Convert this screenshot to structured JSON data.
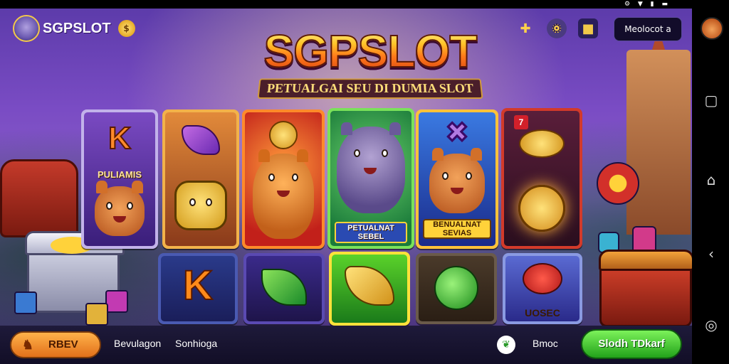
{
  "app": {
    "logo_text": "SGPSLOT",
    "user_field_text": "Meolocot a"
  },
  "hero": {
    "title": "SGPSLOT",
    "subtitle": "PETUALGAI SEU DI DUMIA SLOT"
  },
  "cards_top": [
    {
      "label": "PULIAMIS",
      "glyph": "K",
      "accent": "#6a3ab0"
    },
    {
      "label": "",
      "glyph": "",
      "accent": "#d2702a"
    },
    {
      "label": "",
      "glyph": "",
      "accent": "#d2302a"
    },
    {
      "label": "PETUALNAT SEBEL",
      "glyph": "",
      "accent": "#2ab24a"
    },
    {
      "label": "BENUALNAT SEVIAS",
      "glyph": "",
      "accent": "#2a6ad2"
    },
    {
      "label": "",
      "glyph": "",
      "accent": "#6a1e3a"
    }
  ],
  "cards_bottom": [
    {
      "label": "",
      "glyph": "K",
      "accent": "#2a3a8a"
    },
    {
      "label": "",
      "glyph": "",
      "accent": "#3a2a8a"
    },
    {
      "label": "",
      "glyph": "",
      "accent": "#3ab22a"
    },
    {
      "label": "",
      "glyph": "",
      "accent": "#3a2a5a"
    },
    {
      "label": "UOSEC",
      "glyph": "",
      "accent": "#5a6ad2"
    }
  ],
  "bottom": {
    "left_button": "RBEV",
    "text_1": "Bevulagon",
    "text_2": "Sonhioga",
    "text_3": "Bmoc",
    "right_button": "Slodh TDkarf"
  },
  "colors": {
    "primary_button": "#22a21a",
    "secondary_button": "#e2701a"
  },
  "icons": [
    "coin-icon",
    "plus-icon",
    "gear-icon",
    "chest-icon",
    "leaf-icon",
    "recent-apps-icon",
    "home-icon",
    "back-icon",
    "assistant-icon"
  ]
}
